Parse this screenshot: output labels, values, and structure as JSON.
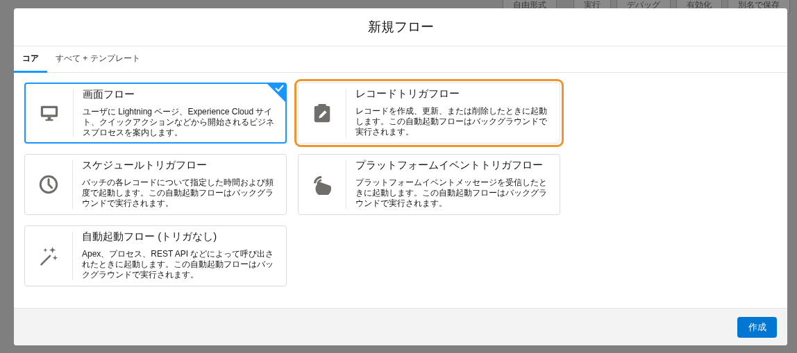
{
  "background_toolbar": [
    "自由形式",
    "実行",
    "デバッグ",
    "有効化",
    "別名で保存"
  ],
  "modal": {
    "title": "新規フロー",
    "tabs": [
      {
        "label": "コア",
        "selected": true
      },
      {
        "label": "すべて + テンプレート",
        "selected": false
      }
    ],
    "flow_types": [
      {
        "kind": "screen",
        "title": "画面フロー",
        "description": "ユーザに Lightning ページ、Experience Cloud サイト、クイックアクションなどから開始されるビジネスプロセスを案内します。",
        "selected": true,
        "highlighted": false
      },
      {
        "kind": "record",
        "title": "レコードトリガフロー",
        "description": "レコードを作成、更新、または削除したときに起動します。この自動起動フローはバックグラウンドで実行されます。",
        "selected": false,
        "highlighted": true
      },
      {
        "kind": "schedule",
        "title": "スケジュールトリガフロー",
        "description": "バッチの各レコードについて指定した時間および頻度で起動します。この自動起動フローはバックグラウンドで実行されます。",
        "selected": false,
        "highlighted": false
      },
      {
        "kind": "platform",
        "title": "プラットフォームイベントトリガフロー",
        "description": "プラットフォームイベントメッセージを受信したときに起動します。この自動起動フローはバックグラウンドで実行されます。",
        "selected": false,
        "highlighted": false
      },
      {
        "kind": "autolaunch",
        "title": "自動起動フロー (トリガなし)",
        "description": "Apex、プロセス、REST API などによって呼び出されたときに起動します。この自動起動フローはバックグラウンドで実行されます。",
        "selected": false,
        "highlighted": false
      }
    ],
    "create_button": "作成"
  }
}
